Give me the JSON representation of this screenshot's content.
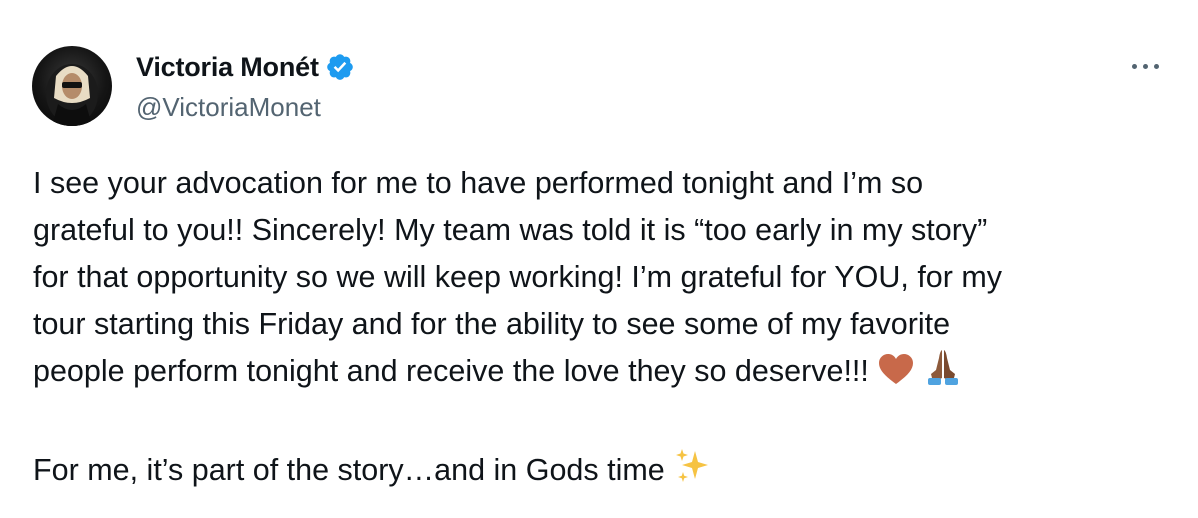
{
  "author": {
    "display_name": "Victoria Monét",
    "handle": "@VictoriaMonet",
    "verified": true,
    "verified_color": "#1d9bf0"
  },
  "more_menu_icon": "more-horizontal-icon",
  "tweet": {
    "lines": [
      "I see your advocation for me to have performed tonight and I’m so",
      "grateful to you!! Sincerely! My team was told it is “too early in my story”",
      "for that opportunity so we will keep working! I’m grateful for YOU, for my",
      "tour starting this Friday and for the ability to see some of my favorite",
      "people perform tonight and receive the love they so deserve!!!",
      "For me, it’s part of the story…and in Gods time"
    ],
    "emojis": {
      "heart": "heart-icon",
      "praying_hands": "praying-hands-icon",
      "sparkles": "sparkles-icon"
    }
  },
  "colors": {
    "text": "#0f1419",
    "secondary_text": "#536471",
    "background": "#ffffff"
  }
}
